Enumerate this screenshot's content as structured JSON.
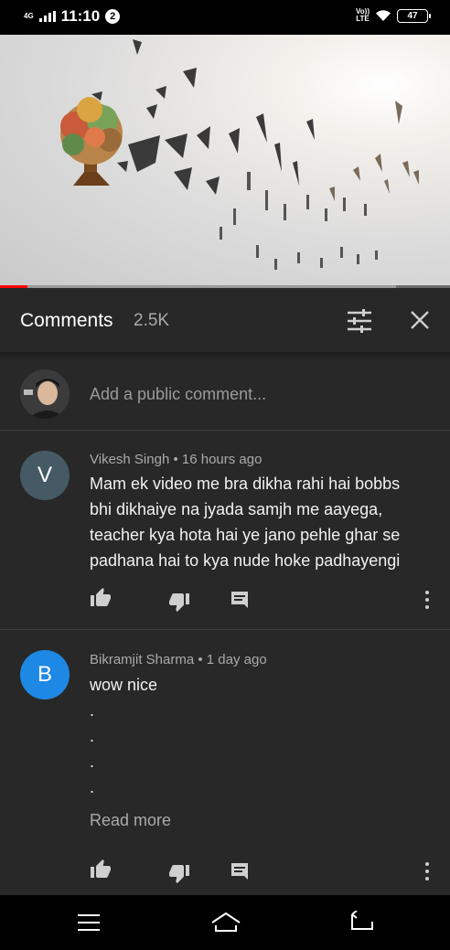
{
  "status_bar": {
    "network": "4G",
    "time": "11:10",
    "notification_count": "2",
    "volte_top": "Vo))",
    "volte_bottom": "LTE",
    "battery": "47"
  },
  "video": {
    "progress": 0.06,
    "buffered": 0.88,
    "accent_color": "#ff0000"
  },
  "comments_panel": {
    "title": "Comments",
    "count": "2.5K",
    "add_placeholder": "Add a public comment..."
  },
  "comments": [
    {
      "avatar_letter": "V",
      "avatar_color": "#455a64",
      "author": "Vikesh Singh",
      "time": "16 hours ago",
      "lines": [
        "Mam ek video me bra dikha rahi hai bobbs",
        "bhi dikhaiye na jyada samjh me aayega,",
        "teacher  kya hota hai ye jano pehle ghar se",
        "padhana hai to kya nude hoke padhayengi"
      ]
    },
    {
      "avatar_letter": "B",
      "avatar_color": "#1e88e5",
      "author": "Bikramjit Sharma",
      "time": "1 day ago",
      "lines": [
        "wow nice",
        ".",
        ".",
        ".",
        "."
      ],
      "read_more": "Read more"
    }
  ],
  "icons": {
    "like": "thumb-up-icon",
    "dislike": "thumb-down-icon",
    "reply": "reply-icon",
    "more": "more-vert-icon",
    "sort": "sort-icon",
    "close": "close-icon"
  }
}
